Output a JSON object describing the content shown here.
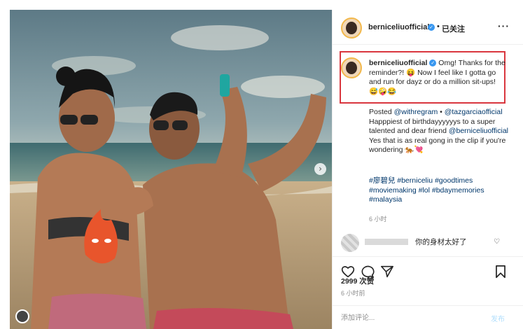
{
  "post": {
    "photo_icon": "beach-photo",
    "next_glyph": "›"
  },
  "header": {
    "username": "berniceliuofficial",
    "verified_glyph": "✓",
    "separator": "•",
    "follow_status": "已关注",
    "more_glyph": "···"
  },
  "caption": {
    "username": "berniceliuofficial",
    "text": "Omg! Thanks for the reminder?! 😝 Now I feel like I gotta go and run for dayz or do a million sit-ups! 😅🤪😂"
  },
  "body": {
    "posted_prefix": "Posted ",
    "posted_mention": "@withregram",
    "posted_sep": " •",
    "mention2": "@tazgarciaofficial",
    "text1": " Happpiest of birthdayyyyyys to a super talented and dear friend ",
    "mention3": "@berniceliuofficial",
    "text2": " Yes that is as real gong in the clip if you're wondering 🐅💘"
  },
  "hashtags": "#廖碧兒 #berniceliu #goodtimes #moviemaking #lol #bdaymemories #malaysia",
  "time_ago": "6 小时",
  "comment": {
    "text": "你的身材太好了",
    "like_glyph": "♡"
  },
  "actions": {
    "like_icon": "heart-icon",
    "comment_icon": "comment-icon",
    "share_icon": "share-icon",
    "save_icon": "bookmark-icon"
  },
  "likes": "2999 次赞",
  "post_time": "6 小时前",
  "composer": {
    "placeholder": "添加评论...",
    "post_label": "发布"
  },
  "colors": {
    "highlight": "#d9363e",
    "link": "#00376b",
    "verified": "#3897f0"
  }
}
